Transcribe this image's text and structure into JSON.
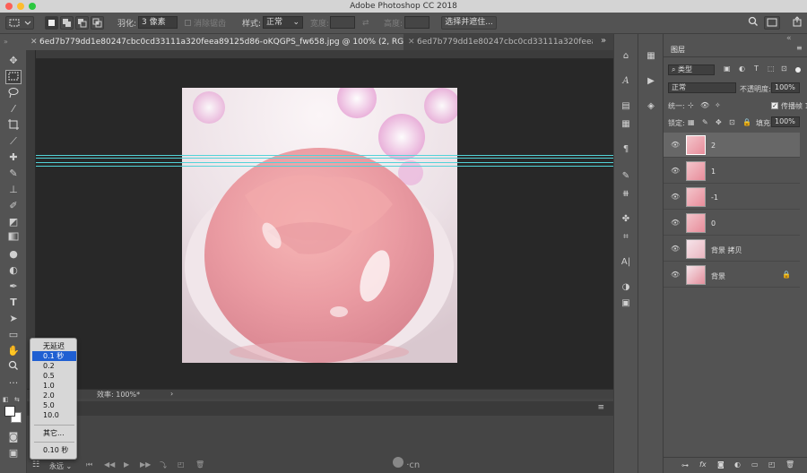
{
  "app": {
    "title": "Adobe Photoshop CC 2018"
  },
  "options_bar": {
    "feather_label": "羽化:",
    "feather_value": "3 像素",
    "antialias_label": "消除锯齿",
    "style_label": "样式:",
    "style_value": "正常",
    "width_label": "宽度:",
    "height_label": "高度:",
    "select_mask_button": "选择并遮住..."
  },
  "tabs": [
    {
      "label": "6ed7b779dd1e80247cbc0cd33111a320feea89125d86-oKQGPS_fw658.jpg @ 100% (2, RGB/8#) *",
      "active": true
    },
    {
      "label": "6ed7b779dd1e80247cbc0cd33111a320feea89",
      "active": false
    }
  ],
  "status_bar": {
    "text": "效率: 100%*"
  },
  "frame_delay_menu": {
    "items": [
      "无延迟",
      "0.1 秒",
      "0.2",
      "0.5",
      "1.0",
      "2.0",
      "5.0",
      "10.0"
    ],
    "selected": "0.1 秒",
    "other": "其它...",
    "current": "0.10 秒"
  },
  "timeline": {
    "loop_value": "永远"
  },
  "layers_panel": {
    "title": "图层",
    "filter_kind": "类型",
    "blend_mode": "正常",
    "opacity_label": "不透明度:",
    "opacity_value": "100%",
    "unify_label": "统一:",
    "propagate_label": "传播帧 1",
    "lock_label": "锁定:",
    "fill_label": "填充:",
    "fill_value": "100%",
    "layers": [
      {
        "name": "2",
        "selected": true,
        "locked": false
      },
      {
        "name": "1",
        "selected": false,
        "locked": false
      },
      {
        "name": "-1",
        "selected": false,
        "locked": false
      },
      {
        "name": "0",
        "selected": false,
        "locked": false
      },
      {
        "name": "背景 拷贝",
        "selected": false,
        "locked": false
      },
      {
        "name": "背景",
        "selected": false,
        "locked": true
      }
    ]
  },
  "watermark": {
    "text": "·cn"
  },
  "colors": {
    "guide": "#52d3d8",
    "selection": "#1f5fd2",
    "canvas_bg": "#282828"
  }
}
